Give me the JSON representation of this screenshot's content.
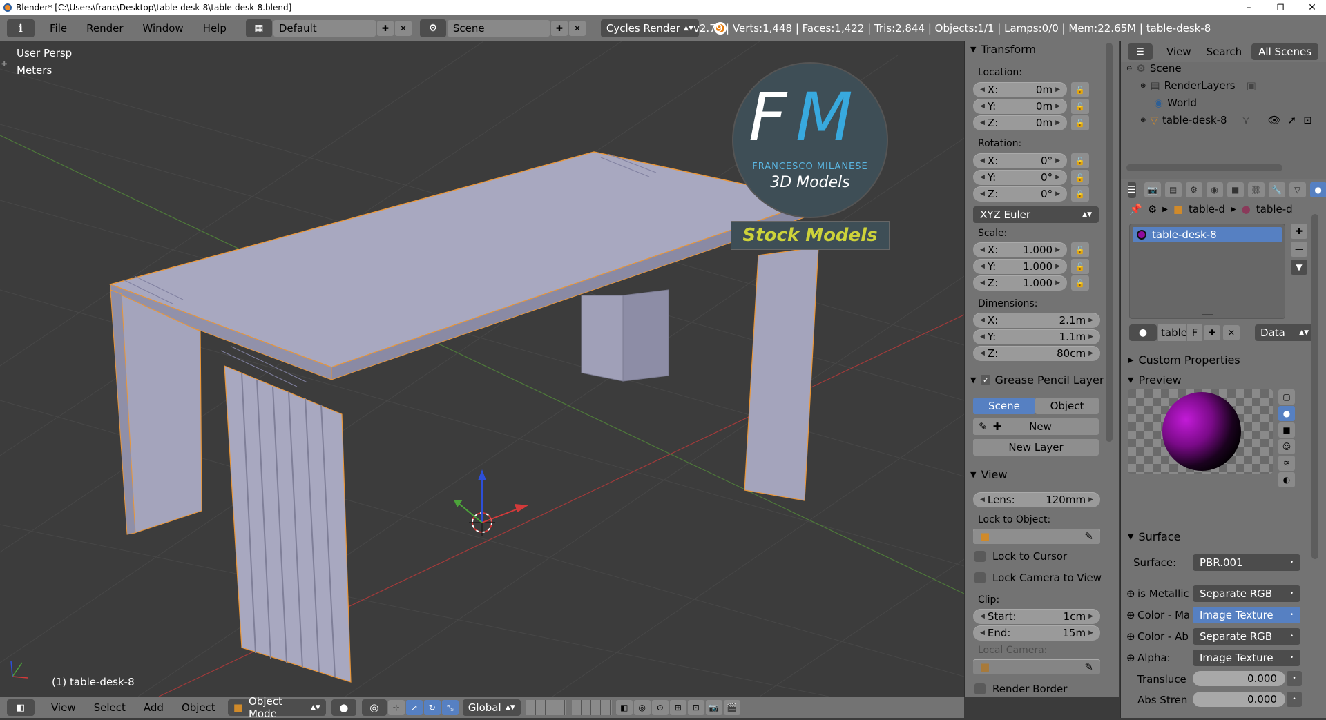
{
  "window": {
    "title": "Blender* [C:\\Users\\franc\\Desktop\\table-desk-8\\table-desk-8.blend]",
    "minimize": "–",
    "maximize": "❐",
    "close": "✕"
  },
  "menubar": {
    "info_icon": "ℹ",
    "menus": [
      "File",
      "Render",
      "Window",
      "Help"
    ],
    "layout_name": "Default",
    "scene_name": "Scene",
    "render_engine": "Cycles Render",
    "stats": "v2.79 | Verts:1,448 | Faces:1,422 | Tris:2,844 | Objects:1/1 | Lamps:0/0 | Mem:22.65M | table-desk-8"
  },
  "viewport": {
    "view_name": "User Persp",
    "units": "Meters",
    "object_label": "(1) table-desk-8",
    "watermark": {
      "initial_f": "F",
      "initial_m": "M",
      "brand": "FRANCESCO MILANESE",
      "sub": "3D Models",
      "banner": "Stock Models"
    },
    "colors": {
      "bg": "#3c3c3c",
      "grid": "#484848",
      "x_axis": "#b13c3c",
      "y_axis": "#5a8f3a",
      "mesh": "#a8a8c0",
      "mesh_dark": "#8d8da8",
      "outline": "#e8963a"
    }
  },
  "transform": {
    "title": "Transform",
    "location_label": "Location:",
    "location": [
      {
        "axis": "X:",
        "value": "0m"
      },
      {
        "axis": "Y:",
        "value": "0m"
      },
      {
        "axis": "Z:",
        "value": "0m"
      }
    ],
    "rotation_label": "Rotation:",
    "rotation": [
      {
        "axis": "X:",
        "value": "0°"
      },
      {
        "axis": "Y:",
        "value": "0°"
      },
      {
        "axis": "Z:",
        "value": "0°"
      }
    ],
    "rotation_mode": "XYZ Euler",
    "scale_label": "Scale:",
    "scale": [
      {
        "axis": "X:",
        "value": "1.000"
      },
      {
        "axis": "Y:",
        "value": "1.000"
      },
      {
        "axis": "Z:",
        "value": "1.000"
      }
    ],
    "dimensions_label": "Dimensions:",
    "dimensions": [
      {
        "axis": "X:",
        "value": "2.1m"
      },
      {
        "axis": "Y:",
        "value": "1.1m"
      },
      {
        "axis": "Z:",
        "value": "80cm"
      }
    ]
  },
  "grease_pencil": {
    "title": "Grease Pencil Layer",
    "scene_tab": "Scene",
    "object_tab": "Object",
    "new_label": "New",
    "new_layer_label": "New Layer"
  },
  "view_panel": {
    "title": "View",
    "lens_label": "Lens:",
    "lens_value": "120mm",
    "lock_object_label": "Lock to Object:",
    "lock_cursor": "Lock to Cursor",
    "lock_camera": "Lock Camera to View",
    "clip_label": "Clip:",
    "clip_start_label": "Start:",
    "clip_start": "1cm",
    "clip_end_label": "End:",
    "clip_end": "15m",
    "local_camera": "Local Camera:",
    "render_border": "Render Border"
  },
  "outliner": {
    "view_menu": "View",
    "search_menu": "Search",
    "filter": "All Scenes",
    "items": [
      {
        "label": "Scene",
        "depth": 0
      },
      {
        "label": "RenderLayers",
        "depth": 1
      },
      {
        "label": "World",
        "depth": 1
      },
      {
        "label": "table-desk-8",
        "depth": 1
      }
    ]
  },
  "properties": {
    "breadcrumb_obj": "table-d",
    "breadcrumb_mat": "table-d",
    "material_slot": "table-desk-8",
    "material_short": "table-",
    "fake_user": "F",
    "link_mode": "Data",
    "custom_props": "Custom Properties",
    "preview": "Preview",
    "surface_title": "Surface",
    "surface_label": "Surface:",
    "surface_value": "PBR.001",
    "inputs": [
      {
        "label": "is Metallic",
        "value": "Separate RGB",
        "highlight": false
      },
      {
        "label": "Color - Ma",
        "value": "Image Texture",
        "highlight": true
      },
      {
        "label": "Color - Ab",
        "value": "Separate RGB",
        "highlight": false
      },
      {
        "label": "Alpha:",
        "value": "Image Texture",
        "highlight": false
      }
    ],
    "translucent_label": "Transluce",
    "translucent_value": "0.000",
    "abs_label": "Abs Stren",
    "abs_value": "0.000"
  },
  "bottombar": {
    "menus": [
      "View",
      "Select",
      "Add",
      "Object"
    ],
    "mode": "Object Mode",
    "orientation": "Global"
  }
}
